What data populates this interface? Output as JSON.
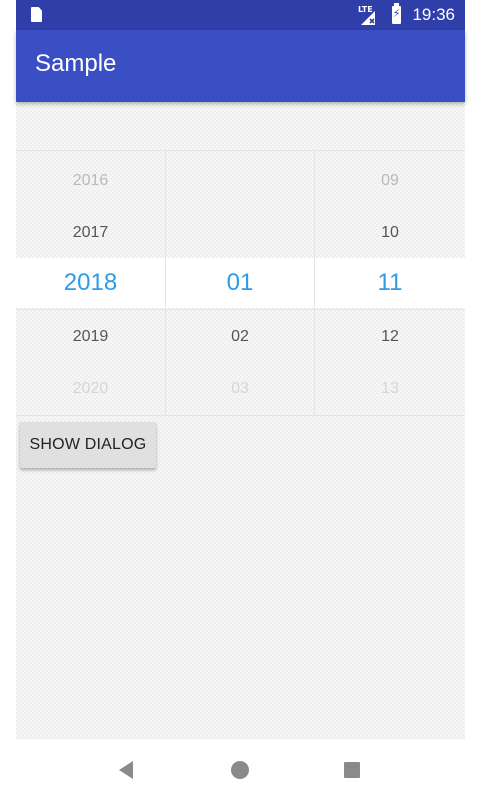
{
  "status_bar": {
    "network_label": "LTE",
    "time": "19:36",
    "icons": [
      "sd-card-icon",
      "signal-icon",
      "battery-charging-icon"
    ]
  },
  "app_bar": {
    "title": "Sample",
    "color": "#3b4fc4"
  },
  "picker": {
    "accent_color": "#2e9be6",
    "columns": [
      {
        "name": "year",
        "items": [
          "2016",
          "2017",
          "2018",
          "2019",
          "2020"
        ],
        "selected": "2018"
      },
      {
        "name": "day",
        "items": [
          "",
          "",
          "01",
          "02",
          "03"
        ],
        "selected": "01"
      },
      {
        "name": "month",
        "items": [
          "09",
          "10",
          "11",
          "12",
          "13"
        ],
        "selected": "11"
      }
    ]
  },
  "actions": {
    "show_dialog_label": "SHOW DIALOG"
  },
  "nav_bar": {
    "icons": [
      "back-icon",
      "home-icon",
      "recents-icon"
    ]
  }
}
